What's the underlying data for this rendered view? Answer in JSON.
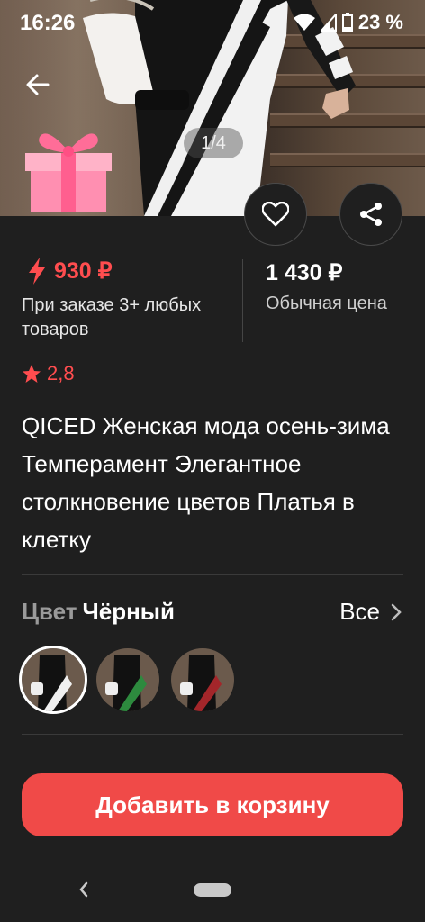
{
  "status_bar": {
    "time": "16:26",
    "battery": "23 %",
    "icons": [
      "wifi-icon",
      "signal-icon",
      "battery-icon"
    ]
  },
  "gallery": {
    "counter": "1/4",
    "icons": [
      "back-arrow-icon",
      "gift-icon",
      "heart-icon",
      "share-icon"
    ]
  },
  "price": {
    "sale_value": "930 ₽",
    "sale_note": "При заказе 3+ любых товаров",
    "regular_value": "1 430 ₽",
    "regular_note": "Обычная цена",
    "sale_icon": "lightning-icon"
  },
  "rating": {
    "value": "2,8",
    "icon": "star-icon"
  },
  "product": {
    "title": "QICED Женская мода осень-зима Темперамент Элегантное столкновение цветов Платья в клетку"
  },
  "color": {
    "label": "Цвет",
    "selected": "Чёрный",
    "all_label": "Все",
    "swatches": [
      {
        "name": "white-stripe",
        "selected": true
      },
      {
        "name": "green-stripe",
        "selected": false
      },
      {
        "name": "red-stripe",
        "selected": false
      }
    ]
  },
  "cart": {
    "add_label": "Добавить в корзину"
  },
  "colors": {
    "background": "#1f1f1f",
    "accent": "#f04a48",
    "price_red": "#ff4d4f"
  }
}
